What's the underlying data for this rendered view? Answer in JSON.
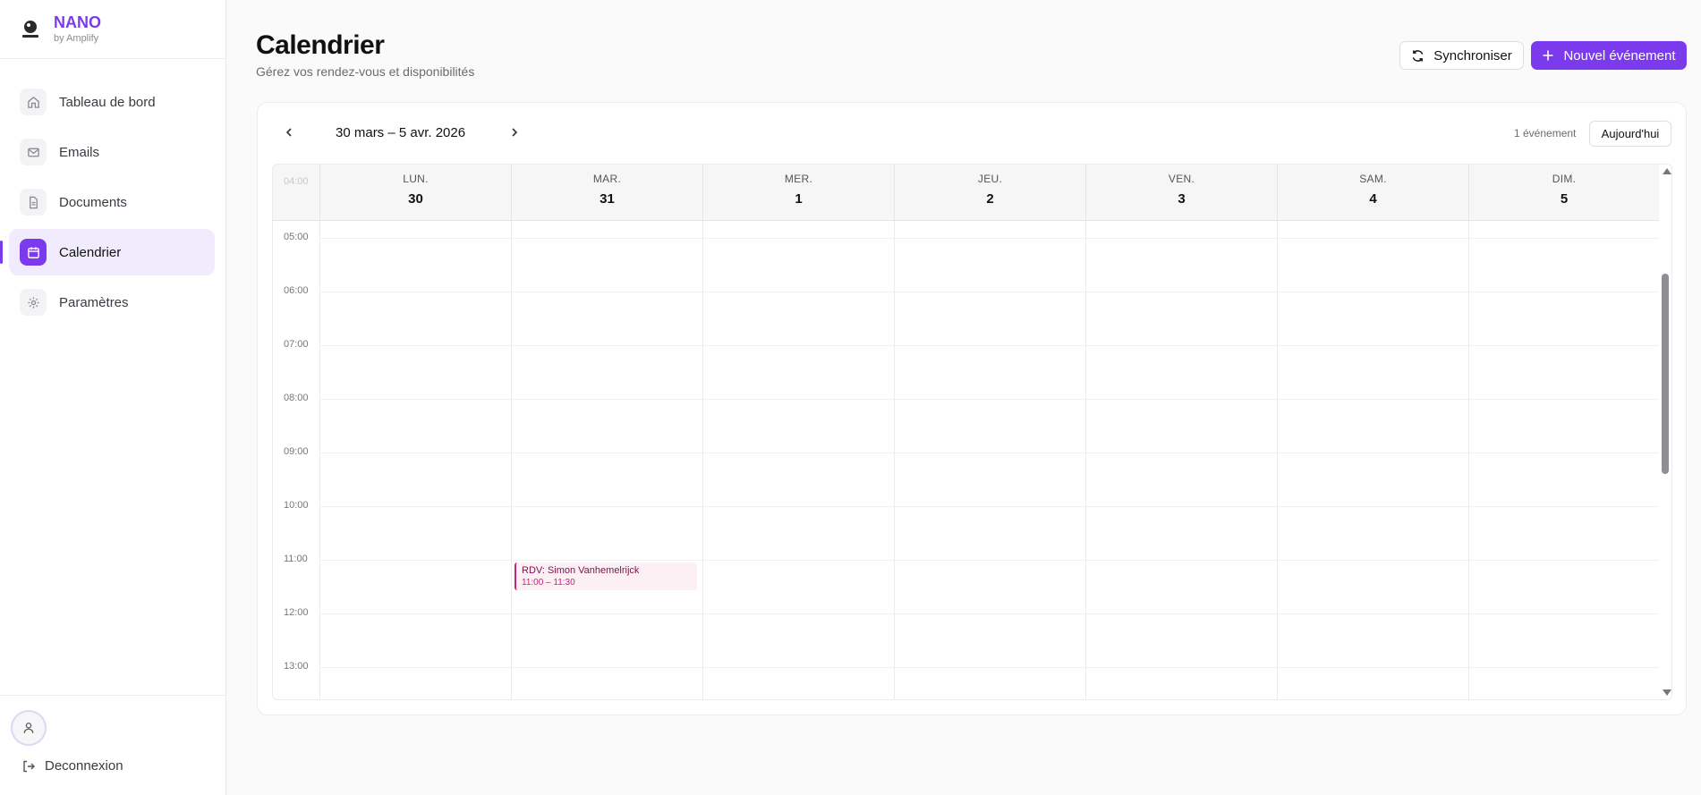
{
  "app": {
    "name": "NANO",
    "tagline": "by Amplify",
    "accent_color": "#7c3aed"
  },
  "sidebar": {
    "items": [
      {
        "label": "Tableau de bord",
        "icon": "home-icon"
      },
      {
        "label": "Emails",
        "icon": "mail-icon"
      },
      {
        "label": "Documents",
        "icon": "document-icon"
      },
      {
        "label": "Calendrier",
        "icon": "calendar-icon",
        "active": true
      },
      {
        "label": "Paramètres",
        "icon": "gear-icon"
      }
    ],
    "logout_label": "Deconnexion"
  },
  "header": {
    "title": "Calendrier",
    "subtitle": "Gérez vos rendez-vous et disponibilités",
    "sync_label": "Synchroniser",
    "new_event_label": "Nouvel événement"
  },
  "calendar": {
    "range_label": "30 mars – 5 avr. 2026",
    "event_count": "1 événement",
    "today_label": "Aujourd'hui",
    "partial_hour_label": "04:00",
    "days": [
      {
        "name": "LUN.",
        "num": "30"
      },
      {
        "name": "MAR.",
        "num": "31"
      },
      {
        "name": "MER.",
        "num": "1"
      },
      {
        "name": "JEU.",
        "num": "2"
      },
      {
        "name": "VEN.",
        "num": "3"
      },
      {
        "name": "SAM.",
        "num": "4"
      },
      {
        "name": "DIM.",
        "num": "5"
      }
    ],
    "hours": [
      "05:00",
      "06:00",
      "07:00",
      "08:00",
      "09:00",
      "10:00",
      "11:00",
      "12:00",
      "13:00"
    ],
    "events": [
      {
        "title": "RDV: Simon Vanhemelrijck",
        "time": "11:00 – 11:30",
        "day": "MAR.",
        "color": "#c0267a"
      }
    ]
  }
}
